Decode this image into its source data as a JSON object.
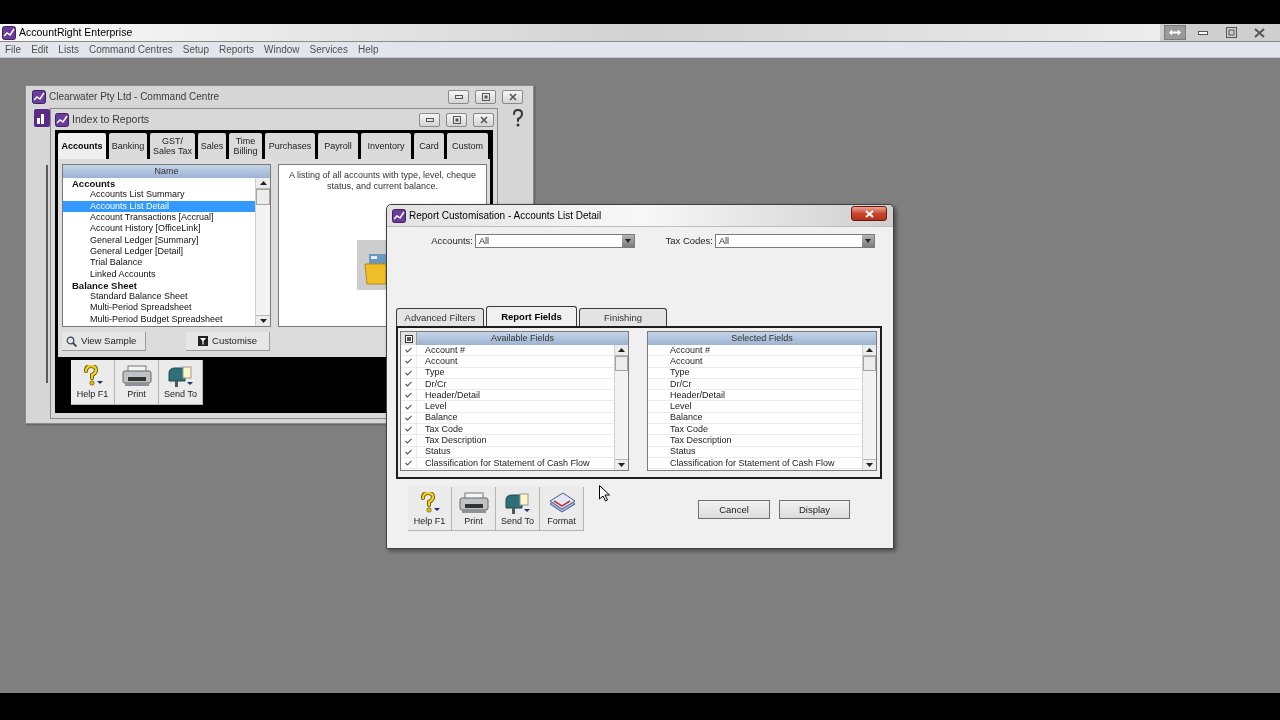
{
  "app": {
    "title": "AccountRight Enterprise"
  },
  "menu": [
    "File",
    "Edit",
    "Lists",
    "Command Centres",
    "Setup",
    "Reports",
    "Window",
    "Services",
    "Help"
  ],
  "command_centre": {
    "title": "Clearwater Pty Ltd - Command Centre"
  },
  "index_to_reports": {
    "title": "Index to Reports",
    "tabs": [
      {
        "label": "Accounts",
        "selected": true
      },
      {
        "label": "Banking",
        "selected": false
      },
      {
        "label": "GST/\nSales Tax",
        "selected": false
      },
      {
        "label": "Sales",
        "selected": false
      },
      {
        "label": "Time\nBilling",
        "selected": false
      },
      {
        "label": "Purchases",
        "selected": false
      },
      {
        "label": "Payroll",
        "selected": false
      },
      {
        "label": "Inventory",
        "selected": false
      },
      {
        "label": "Card",
        "selected": false
      },
      {
        "label": "Custom",
        "selected": false
      }
    ],
    "list": {
      "header": "Name",
      "items": [
        {
          "label": "Accounts",
          "selected": false,
          "children": [
            {
              "label": "Accounts List Summary",
              "selected": false
            },
            {
              "label": "Accounts List Detail",
              "selected": true
            },
            {
              "label": "Account Transactions [Accrual]",
              "selected": false
            },
            {
              "label": "Account History [OfficeLink]",
              "selected": false
            },
            {
              "label": "General Ledger [Summary]",
              "selected": false
            },
            {
              "label": "General Ledger [Detail]",
              "selected": false
            },
            {
              "label": "Trial Balance",
              "selected": false
            },
            {
              "label": "Linked Accounts",
              "selected": false
            }
          ]
        },
        {
          "label": "Balance Sheet",
          "selected": false,
          "children": [
            {
              "label": "Standard Balance Sheet",
              "selected": false
            },
            {
              "label": "Multi-Period Spreadsheet",
              "selected": false
            },
            {
              "label": "Multi-Period Budget Spreadsheet",
              "selected": false
            }
          ]
        }
      ]
    },
    "description": "A listing of all accounts with type, level, cheque status, and current balance.",
    "buttons": [
      {
        "kind": "view",
        "label": "View Sample"
      },
      {
        "kind": "customise",
        "label": "Customise"
      }
    ],
    "toolbar": [
      {
        "kind": "help",
        "label": "Help F1"
      },
      {
        "kind": "print",
        "label": "Print"
      },
      {
        "kind": "send",
        "label": "Send To"
      }
    ]
  },
  "report_customisation": {
    "title": "Report Customisation - Accounts List Detail",
    "filters": [
      {
        "label": "Accounts:",
        "value": "All"
      },
      {
        "label": "Tax Codes:",
        "value": "All"
      }
    ],
    "tabs": [
      {
        "label": "Advanced Filters",
        "selected": false
      },
      {
        "label": "Report Fields",
        "selected": true
      },
      {
        "label": "Finishing",
        "selected": false
      }
    ],
    "available_fields": {
      "header": "Available Fields",
      "select_all": {
        "checked": true
      },
      "items": [
        {
          "label": "Account #",
          "checked": true
        },
        {
          "label": "Account",
          "checked": true
        },
        {
          "label": "Type",
          "checked": true
        },
        {
          "label": "Dr/Cr",
          "checked": true
        },
        {
          "label": "Header/Detail",
          "checked": true
        },
        {
          "label": "Level",
          "checked": true
        },
        {
          "label": "Balance",
          "checked": true
        },
        {
          "label": "Tax Code",
          "checked": true
        },
        {
          "label": "Tax Description",
          "checked": true
        },
        {
          "label": "Status",
          "checked": true
        },
        {
          "label": "Classification for Statement of Cash Flow",
          "checked": true
        }
      ]
    },
    "selected_fields": {
      "header": "Selected Fields",
      "items": [
        "Account #",
        "Account",
        "Type",
        "Dr/Cr",
        "Header/Detail",
        "Level",
        "Balance",
        "Tax Code",
        "Tax Description",
        "Status",
        "Classification for Statement of Cash Flow"
      ]
    },
    "toolbar": [
      {
        "kind": "help",
        "label": "Help F1"
      },
      {
        "kind": "print",
        "label": "Print"
      },
      {
        "kind": "send",
        "label": "Send To"
      },
      {
        "kind": "format",
        "label": "Format"
      }
    ],
    "buttons": [
      "Cancel",
      "Display"
    ]
  }
}
